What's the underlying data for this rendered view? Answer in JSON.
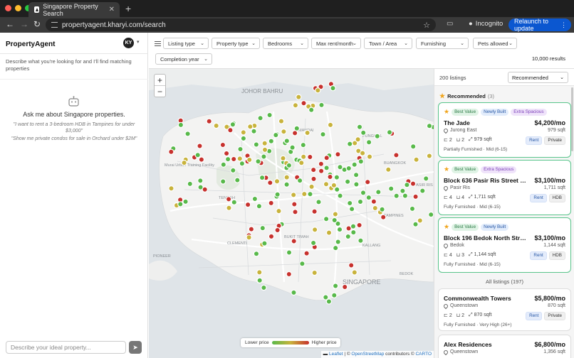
{
  "browser": {
    "tab_title": "Singapore Property Search",
    "url": "propertyagent.kharyi.com/search",
    "incognito_label": "Incognito",
    "relaunch_label": "Relaunch to update"
  },
  "sidebar": {
    "brand": "PropertyAgent",
    "avatar_initials": "KY",
    "intro": "Describe what you're looking for and I'll find matching properties",
    "ask_title": "Ask me about Singapore properties.",
    "examples": [
      "\"I want to rent a 3-bedroom HDB in Tampines for under $3,000\"",
      "\"Show me private condos for sale in Orchard under $2M\""
    ],
    "input_placeholder": "Describe your ideal property..."
  },
  "filters": {
    "items": [
      "Listing type",
      "Property type",
      "Bedrooms",
      "Max rent/month",
      "Town / Area",
      "Furnishing",
      "Pets allowed",
      "Completion year"
    ],
    "total_results": "10,000 results"
  },
  "map": {
    "labels": [
      "JOHOR BAHRU",
      "Murai Urban Training Facility",
      "TENGAH",
      "BUKIT TIMAH",
      "PIONEER",
      "SINGAPORE",
      "PUNGGOL",
      "BUANGKOK",
      "TAMPINES",
      "BEDOK",
      "MANDAI",
      "CLEMENTI",
      "KALLANG",
      "PASIR RIS"
    ],
    "zoom_in": "+",
    "zoom_out": "−",
    "legend_low": "Lower price",
    "legend_high": "Higher price",
    "attribution_leaflet": "Leaflet",
    "attribution_sep": " | © ",
    "attribution_osm": "OpenStreetMap",
    "attribution_mid": " contributors © ",
    "attribution_carto": "CARTO",
    "colors": {
      "low": "#58b94a",
      "mid": "#c8b33c",
      "high": "#c7312d"
    }
  },
  "listings": {
    "count_label": "200 listings",
    "sort_value": "Recommended",
    "recommended_title": "Recommended",
    "recommended_count": "(3)",
    "all_title": "All listings (197)",
    "recommended": [
      {
        "badges": [
          "Best Value",
          "Newly Built",
          "Extra Spacious"
        ],
        "title": "The Jade",
        "price": "$4,200/mo",
        "location": "Jurong East",
        "sqft": "979 sqft",
        "beds": "2",
        "baths": "2",
        "area": "979 sqft",
        "tags": [
          "Rent",
          "Private"
        ],
        "foot": "Partially Furnished · Mid (6-15)"
      },
      {
        "badges": [
          "Best Value",
          "Extra Spacious"
        ],
        "title": "Block 636 Pasir Ris Street 51 #12-...",
        "price": "$3,100/mo",
        "location": "Pasir Ris",
        "sqft": "1,711 sqft",
        "beds": "4",
        "baths": "4",
        "area": "1,711 sqft",
        "tags": [
          "Rent",
          "HDB"
        ],
        "foot": "Fully Furnished · Mid (6-15)"
      },
      {
        "badges": [
          "Best Value",
          "Newly Built"
        ],
        "title": "Block 196 Bedok North Street 3 #...",
        "price": "$3,100/mo",
        "location": "Bedok",
        "sqft": "1,144 sqft",
        "beds": "4",
        "baths": "3",
        "area": "1,144 sqft",
        "tags": [
          "Rent",
          "HDB"
        ],
        "foot": "Fully Furnished · Mid (6-15)"
      }
    ],
    "all": [
      {
        "title": "Commonwealth Towers",
        "price": "$5,800/mo",
        "location": "Queenstown",
        "sqft": "870 sqft",
        "beds": "2",
        "baths": "2",
        "area": "870 sqft",
        "tags": [
          "Rent",
          "Private"
        ],
        "foot": "Fully Furnished · Very High (26+)"
      },
      {
        "title": "Alex Residences",
        "price": "$6,800/mo",
        "location": "Queenstown",
        "sqft": "1,356 sqft"
      }
    ]
  }
}
